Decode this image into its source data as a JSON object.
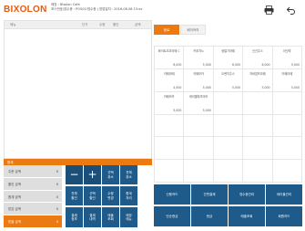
{
  "header": {
    "logo": "BIXOLON",
    "store_line": "매장 : Bixolon Cafe",
    "info_line": "포스번호/영수증 : POS01/영수증  |  영업일자 : 2016-08-08  15:xx",
    "icons": [
      "print-icon",
      "back-icon"
    ]
  },
  "order": {
    "columns": {
      "name": "메뉴",
      "price": "단가",
      "qty": "수량",
      "discount": "할인",
      "amount": "금액"
    }
  },
  "total": {
    "label": "합계"
  },
  "summary": [
    {
      "label": "주문 금액",
      "value": "0"
    },
    {
      "label": "할인 금액",
      "value": "0"
    },
    {
      "label": "합계 금액",
      "value": "0"
    },
    {
      "label": "받은 금액",
      "value": "0"
    },
    {
      "label": "받을 금액",
      "value": "0"
    }
  ],
  "keypad": {
    "minus": "−",
    "plus": "+",
    "keys": [
      "선택\n취소",
      "전체\n취소",
      "전체\n할인",
      "선택\n할인",
      "수량\n변경",
      "합계\n처리",
      "결제\n정보",
      "결제\n내역",
      "매출\n조회",
      "매장\n매뉴"
    ]
  },
  "categories": [
    {
      "label": "음료",
      "active": true
    },
    {
      "label": "베이커리",
      "active": false
    }
  ],
  "products": [
    {
      "name": "화이트초코라떼 C",
      "price": "6,000"
    },
    {
      "name": "카푸치노",
      "price": "5,000"
    },
    {
      "name": "생딸기라떼",
      "price": "6,000"
    },
    {
      "name": "신선주스",
      "price": "6,000"
    },
    {
      "name": "아샷추",
      "price": "5,000"
    },
    {
      "name": "카페라떼",
      "price": "4,500"
    },
    {
      "name": "카페모카",
      "price": "5,000"
    },
    {
      "name": "오렌지주스",
      "price": "5,000"
    },
    {
      "name": "자바칩프라페",
      "price": "5,000"
    },
    {
      "name": "카페라떼",
      "price": "5,000"
    },
    {
      "name": "카페모카",
      "price": "5,000"
    },
    {
      "name": "캐러멜마끼아또",
      "price": "5,000"
    },
    {
      "name": "",
      "price": ""
    },
    {
      "name": "",
      "price": ""
    },
    {
      "name": "",
      "price": ""
    },
    {
      "name": "",
      "price": ""
    },
    {
      "name": "",
      "price": ""
    },
    {
      "name": "",
      "price": ""
    },
    {
      "name": "",
      "price": ""
    },
    {
      "name": "",
      "price": ""
    },
    {
      "name": "",
      "price": ""
    },
    {
      "name": "",
      "price": ""
    },
    {
      "name": "",
      "price": ""
    },
    {
      "name": "",
      "price": ""
    },
    {
      "name": "",
      "price": ""
    },
    {
      "name": "",
      "price": ""
    },
    {
      "name": "",
      "price": ""
    },
    {
      "name": "",
      "price": ""
    },
    {
      "name": "",
      "price": ""
    },
    {
      "name": "",
      "price": ""
    }
  ],
  "functions": [
    "신용카드",
    "간편결제",
    "영수증관리",
    "테이블관리",
    "단순현금",
    "현금",
    "매출조회",
    "회원카드"
  ],
  "colors": {
    "accent": "#ec7a12",
    "key_blue": "#1e5a8a"
  }
}
